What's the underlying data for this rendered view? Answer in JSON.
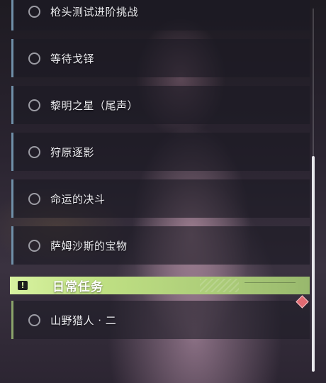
{
  "quests": [
    {
      "label": "枪头测试进阶挑战"
    },
    {
      "label": "等待戈铎"
    },
    {
      "label": "黎明之星（尾声）"
    },
    {
      "label": "狩原逐影"
    },
    {
      "label": "命运的决斗"
    },
    {
      "label": "萨姆沙斯的宝物"
    }
  ],
  "daily_section": {
    "title": "日常任务",
    "icon": "exclamation-icon",
    "accent_color": "#bfe083"
  },
  "daily_quests": [
    {
      "label": "山野猎人 · 二"
    }
  ],
  "colors": {
    "main_quest_border": "#6f8fa8",
    "daily_quest_border": "#8aa36a",
    "alert_icon": "#e06a72"
  }
}
